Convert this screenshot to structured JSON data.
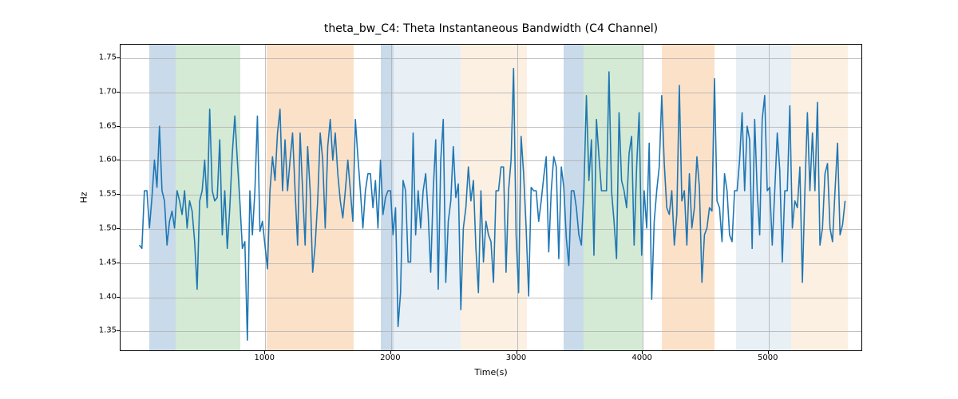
{
  "chart_data": {
    "type": "line",
    "title": "theta_bw_C4: Theta Instantaneous Bandwidth (C4 Channel)",
    "xlabel": "Time(s)",
    "ylabel": "Hz",
    "xlim": [
      -150,
      5750
    ],
    "ylim": [
      1.32,
      1.77
    ],
    "xticks": [
      1000,
      2000,
      3000,
      4000,
      5000
    ],
    "yticks": [
      1.35,
      1.4,
      1.45,
      1.5,
      1.55,
      1.6,
      1.65,
      1.7,
      1.75
    ],
    "shaded_regions": [
      {
        "x0": 80,
        "x1": 290,
        "color": "#5a8fbf"
      },
      {
        "x0": 290,
        "x1": 800,
        "color": "#7bbf7b"
      },
      {
        "x0": 1010,
        "x1": 1700,
        "color": "#f5a35a"
      },
      {
        "x0": 1920,
        "x1": 2020,
        "color": "#5a8fbf"
      },
      {
        "x0": 2020,
        "x1": 2550,
        "color": "#b8cde0"
      },
      {
        "x0": 2550,
        "x1": 3080,
        "color": "#f7d0a8"
      },
      {
        "x0": 3370,
        "x1": 3530,
        "color": "#5a8fbf"
      },
      {
        "x0": 3530,
        "x1": 4000,
        "color": "#7bbf7b"
      },
      {
        "x0": 4150,
        "x1": 4570,
        "color": "#f5a35a"
      },
      {
        "x0": 4740,
        "x1": 4830,
        "color": "#b8cde0"
      },
      {
        "x0": 4830,
        "x1": 5180,
        "color": "#b8cde0"
      },
      {
        "x0": 5180,
        "x1": 5630,
        "color": "#f7d0a8"
      }
    ],
    "series": [
      {
        "name": "theta_bw_C4",
        "color": "#1f77b4",
        "x_step": 20,
        "x_start": 0,
        "values": [
          1.475,
          1.47,
          1.555,
          1.555,
          1.5,
          1.545,
          1.6,
          1.56,
          1.65,
          1.555,
          1.54,
          1.475,
          1.51,
          1.525,
          1.5,
          1.555,
          1.54,
          1.52,
          1.555,
          1.5,
          1.54,
          1.525,
          1.48,
          1.41,
          1.54,
          1.555,
          1.6,
          1.53,
          1.675,
          1.555,
          1.54,
          1.545,
          1.63,
          1.49,
          1.555,
          1.47,
          1.53,
          1.61,
          1.665,
          1.6,
          1.54,
          1.47,
          1.48,
          1.335,
          1.555,
          1.49,
          1.555,
          1.665,
          1.495,
          1.51,
          1.475,
          1.44,
          1.555,
          1.605,
          1.57,
          1.64,
          1.675,
          1.555,
          1.63,
          1.555,
          1.6,
          1.64,
          1.555,
          1.475,
          1.64,
          1.555,
          1.475,
          1.62,
          1.555,
          1.435,
          1.475,
          1.54,
          1.64,
          1.6,
          1.5,
          1.62,
          1.66,
          1.6,
          1.64,
          1.58,
          1.54,
          1.515,
          1.555,
          1.6,
          1.555,
          1.51,
          1.66,
          1.605,
          1.555,
          1.5,
          1.555,
          1.58,
          1.58,
          1.53,
          1.57,
          1.5,
          1.6,
          1.52,
          1.545,
          1.555,
          1.555,
          1.49,
          1.53,
          1.355,
          1.405,
          1.57,
          1.555,
          1.45,
          1.45,
          1.64,
          1.49,
          1.555,
          1.5,
          1.555,
          1.58,
          1.52,
          1.435,
          1.555,
          1.63,
          1.41,
          1.6,
          1.66,
          1.42,
          1.51,
          1.54,
          1.62,
          1.545,
          1.565,
          1.38,
          1.5,
          1.53,
          1.59,
          1.54,
          1.57,
          1.47,
          1.405,
          1.555,
          1.45,
          1.51,
          1.49,
          1.48,
          1.42,
          1.555,
          1.555,
          1.59,
          1.59,
          1.435,
          1.555,
          1.6,
          1.735,
          1.49,
          1.405,
          1.635,
          1.58,
          1.5,
          1.4,
          1.56,
          1.555,
          1.555,
          1.51,
          1.54,
          1.575,
          1.605,
          1.465,
          1.555,
          1.605,
          1.59,
          1.455,
          1.59,
          1.56,
          1.485,
          1.445,
          1.555,
          1.555,
          1.53,
          1.49,
          1.475,
          1.555,
          1.695,
          1.57,
          1.63,
          1.46,
          1.66,
          1.605,
          1.555,
          1.555,
          1.555,
          1.73,
          1.555,
          1.51,
          1.455,
          1.67,
          1.57,
          1.555,
          1.53,
          1.61,
          1.635,
          1.475,
          1.59,
          1.67,
          1.46,
          1.555,
          1.5,
          1.625,
          1.395,
          1.51,
          1.555,
          1.59,
          1.695,
          1.595,
          1.53,
          1.52,
          1.555,
          1.475,
          1.52,
          1.71,
          1.54,
          1.555,
          1.475,
          1.58,
          1.5,
          1.53,
          1.605,
          1.56,
          1.42,
          1.49,
          1.5,
          1.53,
          1.525,
          1.72,
          1.54,
          1.53,
          1.48,
          1.58,
          1.555,
          1.49,
          1.48,
          1.555,
          1.555,
          1.6,
          1.67,
          1.555,
          1.65,
          1.63,
          1.47,
          1.66,
          1.555,
          1.49,
          1.66,
          1.695,
          1.555,
          1.56,
          1.475,
          1.555,
          1.64,
          1.585,
          1.45,
          1.555,
          1.555,
          1.68,
          1.5,
          1.54,
          1.53,
          1.59,
          1.42,
          1.555,
          1.67,
          1.555,
          1.64,
          1.555,
          1.685,
          1.475,
          1.5,
          1.58,
          1.595,
          1.5,
          1.48,
          1.555,
          1.625,
          1.49,
          1.505,
          1.54
        ]
      }
    ]
  }
}
